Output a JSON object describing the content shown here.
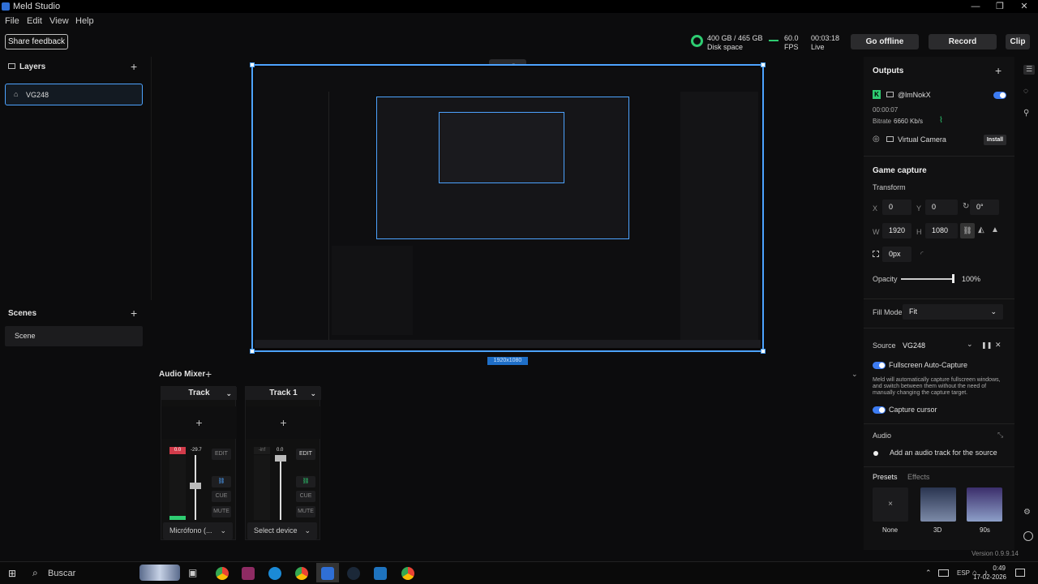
{
  "window": {
    "title": "Meld Studio"
  },
  "menu": [
    "File",
    "Edit",
    "View",
    "Help"
  ],
  "toolbar": {
    "share_feedback": "Share feedback",
    "disk_value": "400 GB / 465 GB",
    "disk_label": "Disk space",
    "fps_value": "60.0",
    "fps_label": "FPS",
    "live_time": "00:03:18",
    "live_label": "Live",
    "go_offline": "Go offline",
    "record": "Record",
    "clip": "Clip"
  },
  "layers": {
    "title": "Layers",
    "items": [
      "VG248"
    ]
  },
  "scenes": {
    "title": "Scenes",
    "items": [
      "Scene"
    ]
  },
  "preview": {
    "resolution": "1920x1080"
  },
  "audio_mixer": {
    "title": "Audio Mixer",
    "tracks": [
      {
        "name": "Track",
        "meter_top": "0.0",
        "meter_db": "-29.7",
        "edit": "EDIT",
        "cue": "CUE",
        "mute": "MUTE",
        "device": "Micrófono (..."
      },
      {
        "name": "Track 1",
        "meter_top": "-inf",
        "meter_db": "0.0",
        "edit": "EDIT",
        "cue": "CUE",
        "mute": "MUTE",
        "device": "Select device"
      }
    ]
  },
  "outputs": {
    "title": "Outputs",
    "account": "@lmNokX",
    "duration": "00:00:07",
    "bitrate_label": "Bitrate",
    "bitrate_value": "6660 Kb/s",
    "virtual_camera": "Virtual Camera",
    "install": "Install"
  },
  "properties": {
    "title": "Game capture",
    "transform": "Transform",
    "x_label": "X",
    "x_value": "0",
    "y_label": "Y",
    "y_value": "0",
    "rotation": "0°",
    "w_label": "W",
    "w_value": "1920",
    "h_label": "H",
    "h_value": "1080",
    "crop_value": "0px",
    "opacity_label": "Opacity",
    "opacity_value": "100%",
    "fill_mode_label": "Fill Mode",
    "fill_mode_value": "Fit",
    "source_label": "Source",
    "source_value": "VG248",
    "fullscreen_label": "Fullscreen Auto-Capture",
    "fullscreen_desc": "Meld will automatically capture fullscreen windows, and switch between them without the need of manually changing the capture target.",
    "capture_cursor": "Capture cursor",
    "audio_label": "Audio",
    "add_audio": "Add an audio track for the source",
    "presets_tab": "Presets",
    "effects_tab": "Effects",
    "presets": [
      "None",
      "3D",
      "90s"
    ]
  },
  "version": "Version 0.9.9.14",
  "taskbar": {
    "search": "Buscar",
    "lang": "ESP",
    "time": "0:49",
    "date": "17-02-2026"
  },
  "colors": {
    "accent": "#4da3ff",
    "live": "#2ecc71",
    "toggle": "#3d7cf2"
  }
}
